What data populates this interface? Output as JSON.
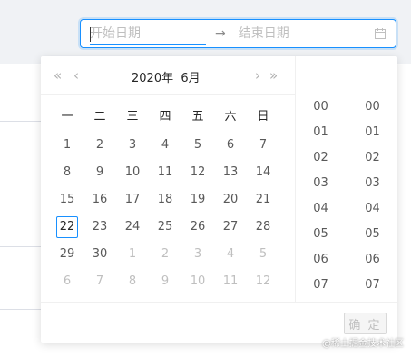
{
  "range": {
    "start_placeholder": "开始日期",
    "separator": "→",
    "end_placeholder": "结束日期",
    "suffix_icon": "calendar-icon"
  },
  "calendar": {
    "nav": {
      "super_prev": "«",
      "prev": "‹",
      "next": "›",
      "super_next": "»"
    },
    "year": "2020年",
    "month": "6月",
    "weekdays": [
      "一",
      "二",
      "三",
      "四",
      "五",
      "六",
      "日"
    ],
    "weeks": [
      [
        {
          "d": "1"
        },
        {
          "d": "2"
        },
        {
          "d": "3"
        },
        {
          "d": "4"
        },
        {
          "d": "5"
        },
        {
          "d": "6"
        },
        {
          "d": "7"
        }
      ],
      [
        {
          "d": "8"
        },
        {
          "d": "9"
        },
        {
          "d": "10"
        },
        {
          "d": "11"
        },
        {
          "d": "12"
        },
        {
          "d": "13"
        },
        {
          "d": "14"
        }
      ],
      [
        {
          "d": "15"
        },
        {
          "d": "16"
        },
        {
          "d": "17"
        },
        {
          "d": "18"
        },
        {
          "d": "19"
        },
        {
          "d": "20"
        },
        {
          "d": "21"
        }
      ],
      [
        {
          "d": "22",
          "today": true
        },
        {
          "d": "23"
        },
        {
          "d": "24"
        },
        {
          "d": "25"
        },
        {
          "d": "26"
        },
        {
          "d": "27"
        },
        {
          "d": "28"
        }
      ],
      [
        {
          "d": "29"
        },
        {
          "d": "30"
        },
        {
          "d": "1",
          "muted": true
        },
        {
          "d": "2",
          "muted": true
        },
        {
          "d": "3",
          "muted": true
        },
        {
          "d": "4",
          "muted": true
        },
        {
          "d": "5",
          "muted": true
        }
      ],
      [
        {
          "d": "6",
          "muted": true
        },
        {
          "d": "7",
          "muted": true
        },
        {
          "d": "8",
          "muted": true
        },
        {
          "d": "9",
          "muted": true
        },
        {
          "d": "10",
          "muted": true
        },
        {
          "d": "11",
          "muted": true
        },
        {
          "d": "12",
          "muted": true
        }
      ]
    ]
  },
  "time": {
    "hours": [
      "00",
      "01",
      "02",
      "03",
      "04",
      "05",
      "06",
      "07"
    ],
    "minutes": [
      "00",
      "01",
      "02",
      "03",
      "04",
      "05",
      "06",
      "07"
    ]
  },
  "footer": {
    "ok_label": "确 定"
  },
  "watermark": "@稀土掘金技术社区",
  "colors": {
    "accent": "#1890ff",
    "muted_text": "#bfbfbf"
  }
}
